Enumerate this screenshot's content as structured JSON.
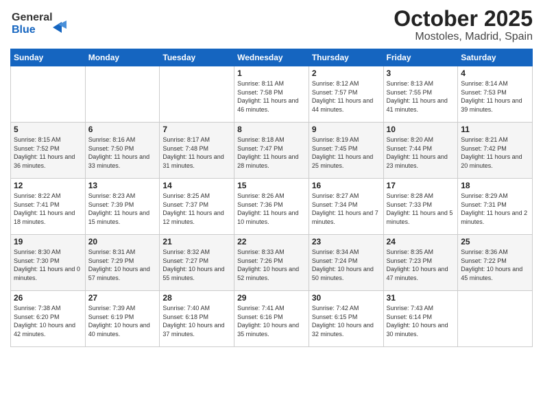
{
  "logo": {
    "line1": "General",
    "line2": "Blue"
  },
  "header": {
    "month": "October 2025",
    "location": "Mostoles, Madrid, Spain"
  },
  "weekdays": [
    "Sunday",
    "Monday",
    "Tuesday",
    "Wednesday",
    "Thursday",
    "Friday",
    "Saturday"
  ],
  "weeks": [
    [
      {
        "day": "",
        "info": ""
      },
      {
        "day": "",
        "info": ""
      },
      {
        "day": "",
        "info": ""
      },
      {
        "day": "1",
        "info": "Sunrise: 8:11 AM\nSunset: 7:58 PM\nDaylight: 11 hours and 46 minutes."
      },
      {
        "day": "2",
        "info": "Sunrise: 8:12 AM\nSunset: 7:57 PM\nDaylight: 11 hours and 44 minutes."
      },
      {
        "day": "3",
        "info": "Sunrise: 8:13 AM\nSunset: 7:55 PM\nDaylight: 11 hours and 41 minutes."
      },
      {
        "day": "4",
        "info": "Sunrise: 8:14 AM\nSunset: 7:53 PM\nDaylight: 11 hours and 39 minutes."
      }
    ],
    [
      {
        "day": "5",
        "info": "Sunrise: 8:15 AM\nSunset: 7:52 PM\nDaylight: 11 hours and 36 minutes."
      },
      {
        "day": "6",
        "info": "Sunrise: 8:16 AM\nSunset: 7:50 PM\nDaylight: 11 hours and 33 minutes."
      },
      {
        "day": "7",
        "info": "Sunrise: 8:17 AM\nSunset: 7:48 PM\nDaylight: 11 hours and 31 minutes."
      },
      {
        "day": "8",
        "info": "Sunrise: 8:18 AM\nSunset: 7:47 PM\nDaylight: 11 hours and 28 minutes."
      },
      {
        "day": "9",
        "info": "Sunrise: 8:19 AM\nSunset: 7:45 PM\nDaylight: 11 hours and 25 minutes."
      },
      {
        "day": "10",
        "info": "Sunrise: 8:20 AM\nSunset: 7:44 PM\nDaylight: 11 hours and 23 minutes."
      },
      {
        "day": "11",
        "info": "Sunrise: 8:21 AM\nSunset: 7:42 PM\nDaylight: 11 hours and 20 minutes."
      }
    ],
    [
      {
        "day": "12",
        "info": "Sunrise: 8:22 AM\nSunset: 7:41 PM\nDaylight: 11 hours and 18 minutes."
      },
      {
        "day": "13",
        "info": "Sunrise: 8:23 AM\nSunset: 7:39 PM\nDaylight: 11 hours and 15 minutes."
      },
      {
        "day": "14",
        "info": "Sunrise: 8:25 AM\nSunset: 7:37 PM\nDaylight: 11 hours and 12 minutes."
      },
      {
        "day": "15",
        "info": "Sunrise: 8:26 AM\nSunset: 7:36 PM\nDaylight: 11 hours and 10 minutes."
      },
      {
        "day": "16",
        "info": "Sunrise: 8:27 AM\nSunset: 7:34 PM\nDaylight: 11 hours and 7 minutes."
      },
      {
        "day": "17",
        "info": "Sunrise: 8:28 AM\nSunset: 7:33 PM\nDaylight: 11 hours and 5 minutes."
      },
      {
        "day": "18",
        "info": "Sunrise: 8:29 AM\nSunset: 7:31 PM\nDaylight: 11 hours and 2 minutes."
      }
    ],
    [
      {
        "day": "19",
        "info": "Sunrise: 8:30 AM\nSunset: 7:30 PM\nDaylight: 11 hours and 0 minutes."
      },
      {
        "day": "20",
        "info": "Sunrise: 8:31 AM\nSunset: 7:29 PM\nDaylight: 10 hours and 57 minutes."
      },
      {
        "day": "21",
        "info": "Sunrise: 8:32 AM\nSunset: 7:27 PM\nDaylight: 10 hours and 55 minutes."
      },
      {
        "day": "22",
        "info": "Sunrise: 8:33 AM\nSunset: 7:26 PM\nDaylight: 10 hours and 52 minutes."
      },
      {
        "day": "23",
        "info": "Sunrise: 8:34 AM\nSunset: 7:24 PM\nDaylight: 10 hours and 50 minutes."
      },
      {
        "day": "24",
        "info": "Sunrise: 8:35 AM\nSunset: 7:23 PM\nDaylight: 10 hours and 47 minutes."
      },
      {
        "day": "25",
        "info": "Sunrise: 8:36 AM\nSunset: 7:22 PM\nDaylight: 10 hours and 45 minutes."
      }
    ],
    [
      {
        "day": "26",
        "info": "Sunrise: 7:38 AM\nSunset: 6:20 PM\nDaylight: 10 hours and 42 minutes."
      },
      {
        "day": "27",
        "info": "Sunrise: 7:39 AM\nSunset: 6:19 PM\nDaylight: 10 hours and 40 minutes."
      },
      {
        "day": "28",
        "info": "Sunrise: 7:40 AM\nSunset: 6:18 PM\nDaylight: 10 hours and 37 minutes."
      },
      {
        "day": "29",
        "info": "Sunrise: 7:41 AM\nSunset: 6:16 PM\nDaylight: 10 hours and 35 minutes."
      },
      {
        "day": "30",
        "info": "Sunrise: 7:42 AM\nSunset: 6:15 PM\nDaylight: 10 hours and 32 minutes."
      },
      {
        "day": "31",
        "info": "Sunrise: 7:43 AM\nSunset: 6:14 PM\nDaylight: 10 hours and 30 minutes."
      },
      {
        "day": "",
        "info": ""
      }
    ]
  ]
}
